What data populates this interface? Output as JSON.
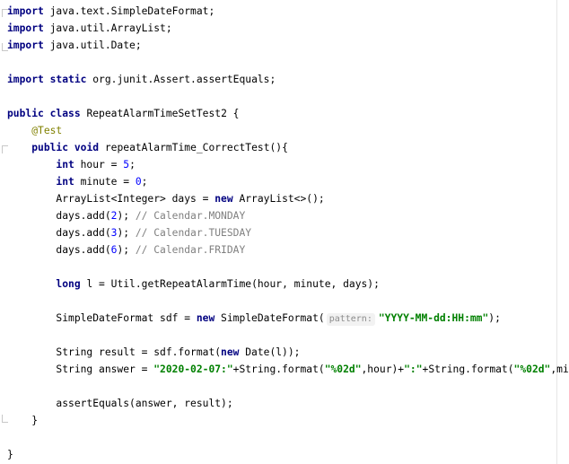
{
  "editor": {
    "lines": [
      [
        {
          "t": "import",
          "c": "kw"
        },
        {
          "t": " java.text.SimpleDateFormat;"
        }
      ],
      [
        {
          "t": "import",
          "c": "kw"
        },
        {
          "t": " java.util.ArrayList;"
        }
      ],
      [
        {
          "t": "import",
          "c": "kw"
        },
        {
          "t": " java.util.Date;"
        }
      ],
      [],
      [
        {
          "t": "import",
          "c": "kw"
        },
        {
          "t": " "
        },
        {
          "t": "static",
          "c": "kw"
        },
        {
          "t": " org.junit.Assert.assertEquals;"
        }
      ],
      [],
      [
        {
          "t": "public",
          "c": "kw"
        },
        {
          "t": " "
        },
        {
          "t": "class",
          "c": "kw"
        },
        {
          "t": " RepeatAlarmTimeSetTest2 {"
        }
      ],
      [
        {
          "t": "    "
        },
        {
          "t": "@Test",
          "c": "ann"
        }
      ],
      [
        {
          "t": "    "
        },
        {
          "t": "public",
          "c": "kw"
        },
        {
          "t": " "
        },
        {
          "t": "void",
          "c": "kw"
        },
        {
          "t": " repeatAlarmTime_CorrectTest(){"
        }
      ],
      [
        {
          "t": "        "
        },
        {
          "t": "int",
          "c": "kw"
        },
        {
          "t": " hour = "
        },
        {
          "t": "5",
          "c": "num"
        },
        {
          "t": ";"
        }
      ],
      [
        {
          "t": "        "
        },
        {
          "t": "int",
          "c": "kw"
        },
        {
          "t": " minute = "
        },
        {
          "t": "0",
          "c": "num"
        },
        {
          "t": ";"
        }
      ],
      [
        {
          "t": "        ArrayList<Integer> days = "
        },
        {
          "t": "new",
          "c": "kw"
        },
        {
          "t": " ArrayList<>();"
        }
      ],
      [
        {
          "t": "        days.add("
        },
        {
          "t": "2",
          "c": "num"
        },
        {
          "t": "); "
        },
        {
          "t": "// Calendar.MONDAY",
          "c": "cmt"
        }
      ],
      [
        {
          "t": "        days.add("
        },
        {
          "t": "3",
          "c": "num"
        },
        {
          "t": "); "
        },
        {
          "t": "// Calendar.TUESDAY",
          "c": "cmt"
        }
      ],
      [
        {
          "t": "        days.add("
        },
        {
          "t": "6",
          "c": "num"
        },
        {
          "t": "); "
        },
        {
          "t": "// Calendar.FRIDAY",
          "c": "cmt"
        }
      ],
      [],
      [
        {
          "t": "        "
        },
        {
          "t": "long",
          "c": "kw"
        },
        {
          "t": " l = Util.getRepeatAlarmTime(hour, minute, days);"
        }
      ],
      [],
      [
        {
          "t": "        SimpleDateFormat sdf = "
        },
        {
          "t": "new",
          "c": "kw"
        },
        {
          "t": " SimpleDateFormat("
        },
        {
          "t": "pattern:",
          "c": "hint"
        },
        {
          "t": "\"YYYY-MM-dd:HH:mm\"",
          "c": "str"
        },
        {
          "t": ");"
        }
      ],
      [],
      [
        {
          "t": "        String result = sdf.format("
        },
        {
          "t": "new",
          "c": "kw"
        },
        {
          "t": " Date(l));"
        }
      ],
      [
        {
          "t": "        String answer = "
        },
        {
          "t": "\"2020-02-07:\"",
          "c": "str"
        },
        {
          "t": "+String.format("
        },
        {
          "t": "\"%02d\"",
          "c": "str"
        },
        {
          "t": ",hour)+"
        },
        {
          "t": "\":\"",
          "c": "str"
        },
        {
          "t": "+String.format("
        },
        {
          "t": "\"%02d\"",
          "c": "str"
        },
        {
          "t": ",minute);"
        }
      ],
      [],
      [
        {
          "t": "        assertEquals(answer, result);"
        }
      ],
      [
        {
          "t": "    }"
        }
      ],
      [],
      [
        {
          "t": "}"
        }
      ]
    ]
  },
  "colors": {
    "keyword": "#000080",
    "number": "#0000ff",
    "string": "#008000",
    "comment": "#808080",
    "annotation": "#808000"
  }
}
